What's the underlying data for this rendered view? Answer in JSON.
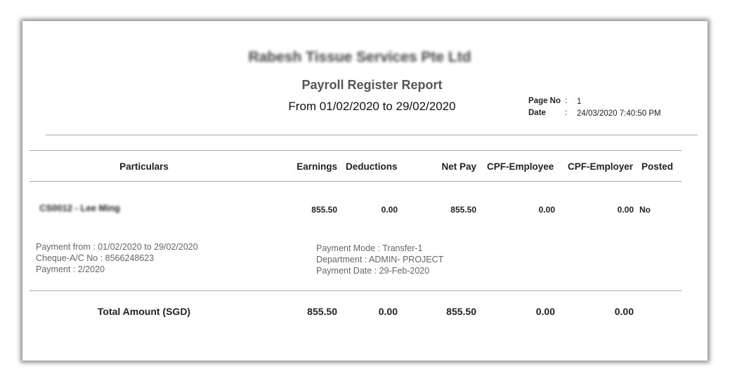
{
  "header": {
    "company_name": "Rabesh Tissue Services Pte Ltd",
    "report_title": "Payroll Register Report",
    "period": "From 01/02/2020 to 29/02/2020",
    "page_label": "Page No",
    "page_value": "1",
    "date_label": "Date",
    "date_value": "24/03/2020 7:40:50 PM"
  },
  "table": {
    "columns": [
      "Particulars",
      "Earnings",
      "Deductions",
      "Net Pay",
      "CPF-Employee",
      "CPF-Employer",
      "Posted"
    ],
    "rows": [
      {
        "particulars": "CS0012 - Lee Ming",
        "earnings": "855.50",
        "deductions": "0.00",
        "net_pay": "855.50",
        "cpf_employee": "0.00",
        "cpf_employer": "0.00",
        "posted": "No",
        "details_left": [
          "Payment from : 01/02/2020 to 29/02/2020",
          "Cheque-A/C No : 8566248623",
          "Payment : 2/2020"
        ],
        "details_right": [
          "Payment Mode : Transfer-1",
          "Department : ADMIN- PROJECT",
          "Payment Date : 29-Feb-2020"
        ]
      }
    ],
    "totals": {
      "label": "Total Amount (SGD)",
      "earnings": "855.50",
      "deductions": "0.00",
      "net_pay": "855.50",
      "cpf_employee": "0.00",
      "cpf_employer": "0.00"
    }
  }
}
